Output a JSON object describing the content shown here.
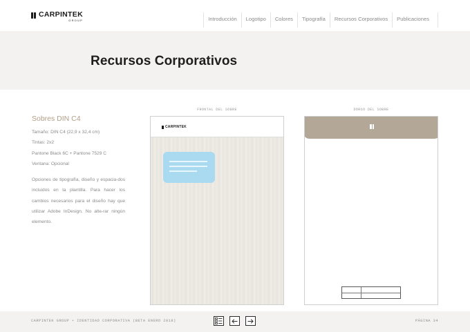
{
  "header": {
    "logo": {
      "name": "CARPINTEK",
      "group": "GROUP"
    },
    "nav": [
      {
        "label": "Introducción"
      },
      {
        "label": "Logotipo"
      },
      {
        "label": "Colores"
      },
      {
        "label": "Tipografía"
      },
      {
        "label": "Recursos Corporativos"
      },
      {
        "label": "Publicaciones"
      }
    ]
  },
  "page": {
    "title": "Recursos Corporativos"
  },
  "spec": {
    "title": "Sobres DIN C4",
    "lines": [
      "Tamaño: DIN C4 (22,9 x 32,4 cm)",
      "Tintas: 2x2",
      "Pantone Black 6C + Pantone 7529 C",
      "Ventana: Opcional"
    ],
    "paragraph": "Opciones de tipografía, diseño y espacia-dos incluidos en la plantilla. Para hacer los cambios necesarios para el diseño hay que utilizar Adobe InDesign. No alte-rar ningún elemento."
  },
  "envelopes": {
    "front_label": "FRONTAL DEL SOBRE",
    "back_label": "DORSO DEL SOBRE",
    "front_logo": "CARPINTEK"
  },
  "footer": {
    "left": "CARPINTEK GROUP • IDENTIDAD CORPORATIVA (BETA ENERO 2018)",
    "right": "PÁGINA 34",
    "buttons": [
      {
        "icon": "index-list-icon"
      },
      {
        "icon": "arrow-left-icon"
      },
      {
        "icon": "arrow-right-icon"
      }
    ]
  },
  "colors": {
    "accent": "#b29d86",
    "flap": "#b3a898",
    "window": "#a9daf0",
    "band": "#f3f2f0"
  }
}
